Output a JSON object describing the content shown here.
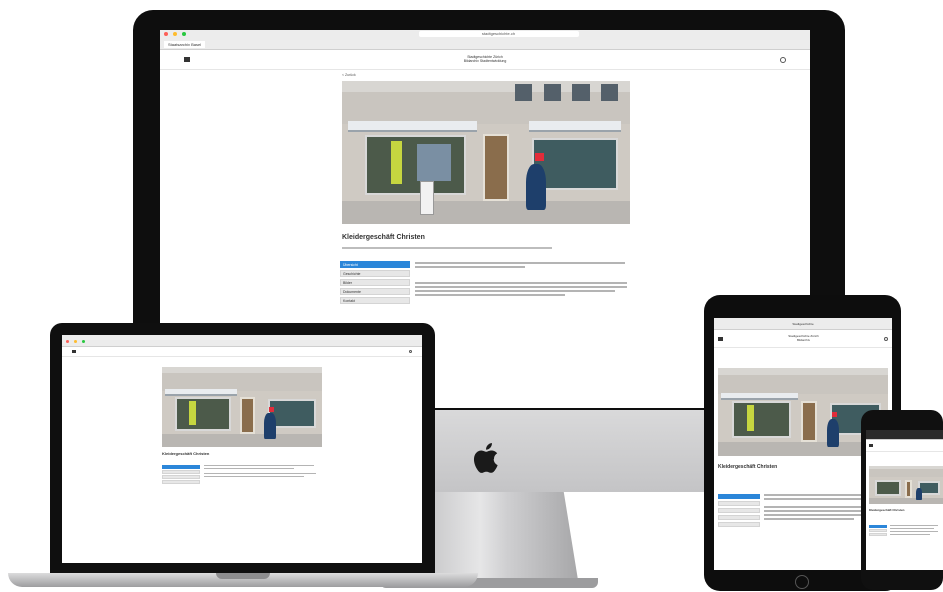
{
  "imac": {
    "tab_label": "Staatsarchiv Basel",
    "url": "stadtgeschichte.ch",
    "site_brand_line1": "Stadtgeschichte Zürich",
    "site_brand_line2": "Bildarchiv Stadtentwicklung",
    "breadcrumb": "< Zurück",
    "page_title": "Kleidergeschäft Christen",
    "menu_items": [
      {
        "label": "Übersicht",
        "active": true
      },
      {
        "label": "Geschichte",
        "active": false
      },
      {
        "label": "Bilder",
        "active": false
      },
      {
        "label": "Dokumente",
        "active": false
      },
      {
        "label": "Kontakt",
        "active": false
      }
    ]
  },
  "laptop": {
    "page_title": "Kleidergeschäft Christen"
  },
  "ipad": {
    "tab_label": "Stadtgeschichte",
    "site_brand_line1": "Stadtgeschichte Zürich",
    "site_brand_line2": "Bildarchiv",
    "page_title": "Kleidergeschäft Christen"
  },
  "phone": {
    "page_title": "Kleidergeschäft Christen"
  },
  "colors": {
    "accent": "#2b86d9",
    "bezel": "#0e0e0e",
    "aluminium": "#d0d0d2"
  }
}
